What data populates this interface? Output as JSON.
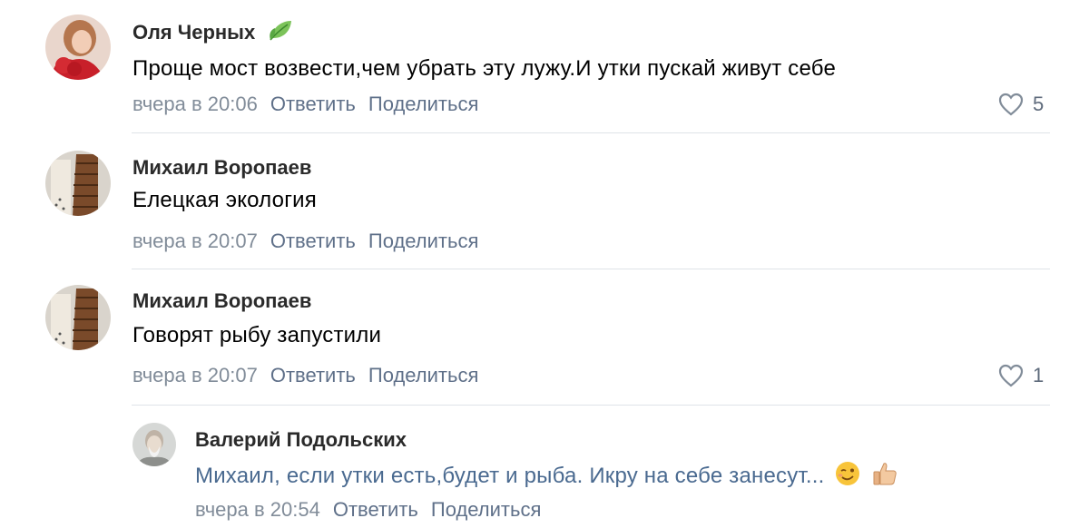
{
  "comments": [
    {
      "author": "Оля Черных",
      "text": "Проще мост возвести,чем убрать эту лужу.И утки пускай живут себе",
      "date": "вчера в 20:06",
      "reply": "Ответить",
      "share": "Поделиться",
      "likes": "5"
    },
    {
      "author": "Михаил Воропаев",
      "text": "Елецкая экология",
      "date": "вчера в 20:07",
      "reply": "Ответить",
      "share": "Поделиться"
    },
    {
      "author": "Михаил Воропаев",
      "text": "Говорят рыбу запустили",
      "date": "вчера в 20:07",
      "reply": "Ответить",
      "share": "Поделиться",
      "likes": "1"
    },
    {
      "author": "Валерий Подольских",
      "text": "Михаил, если утки есть,будет и рыба. Икру на себе занесут...",
      "date": "вчера в 20:54",
      "reply": "Ответить",
      "share": "Поделиться"
    }
  ],
  "colors": {
    "meta": "#818c99",
    "action": "#5f7089",
    "link_name": "#2a5885",
    "divider": "#dfe3e8"
  }
}
